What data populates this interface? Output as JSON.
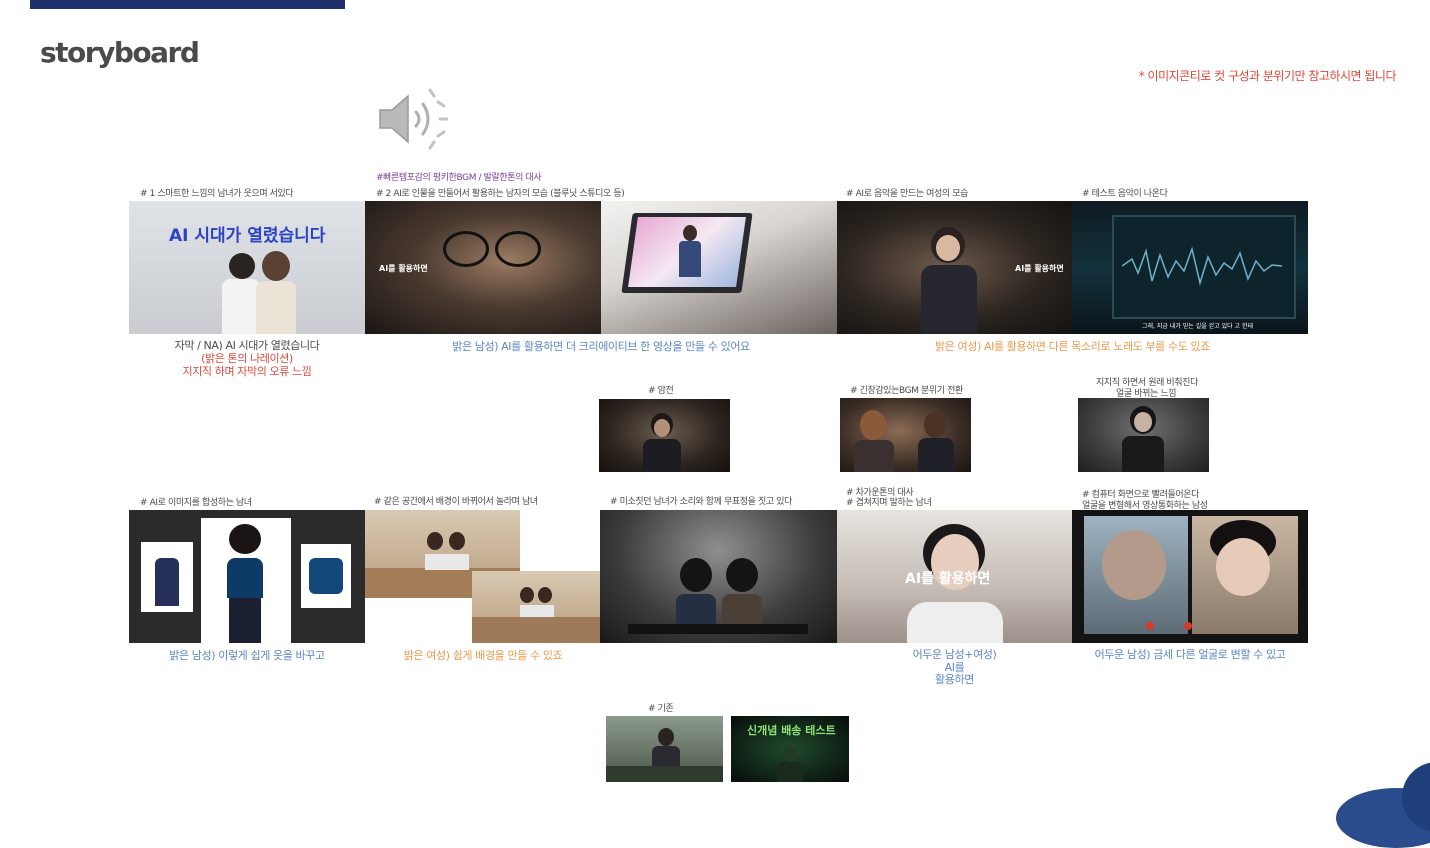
{
  "header": {
    "title": "storyboard",
    "note": "* 이미지콘티로 컷 구성과 분위기만 참고하시면 됩니다",
    "speaker_icon": "speaker-icon"
  },
  "row1": {
    "cap1": "# 1 스마트한 느낌의 남녀가 웃으며 서있다",
    "cap2_bgm": "#빠른템포감의 펑키한BGM / 발랄한톤의 대사",
    "cap2": "# 2 AI로 인물을 만들어서 활용하는 남자의 모습 (블루닛 스튜디오 등)",
    "cap4": "# AI로 음악을 만드는 여성의 모습",
    "cap5": "# 테스트 음악이 나온다",
    "frame1_text": "AI 시대가 열렸습니다",
    "frame2_text": "AI를 활용하면",
    "frame4_text": "AI를 활용하면",
    "frame5_text": "그래, 지금 내가 믿는 길을 걷고 있다 고 한테",
    "sub1_line1": "자막 / NA) AI 시대가 열렸습니다",
    "sub1_line2": "(밝은 톤의 나레이션)",
    "sub1_line3": "지지직 하며 자막의 오류 느낌",
    "sub2": "밝은 남성) AI를 활용하면 더 크리에이티브 한 영상을 만들 수 있어요",
    "sub3": "밝은 여성) AI를 활용하면 다른 목소리로 노래도 부를 수도 있죠"
  },
  "row2": {
    "cap_a": "# 암전",
    "cap_b": "# 긴장감있는BGM 분위기 전환",
    "cap_c_line1": "지지직 하면서 원래 비춰진다",
    "cap_c_line2": "얼굴 바뀌는 느낌"
  },
  "row3": {
    "cap1": "# AI로 이미지를 합성하는 남녀",
    "cap2": "# 같은 공간에서 배경이 바뀌어서 놀라며 남녀",
    "cap3": "# 미소짓던 남녀가 소리와 함께 무표정을 짓고 있다",
    "cap4_line1": "# 차가운톤의 대사",
    "cap4_line2": "# 겹쳐지며 말하는 남녀",
    "cap5_line1": "# 컴퓨터 화면으로 빨려들어온다",
    "cap5_line2": "얼굴을 변형해서 영상통화하는 남성",
    "frame4_text": "AI를 활용하면",
    "sub1": "밝은 남성) 이렇게 쉽게 옷을 바꾸고",
    "sub2": "밝은 여성) 쉽게 배경을 만들 수 있죠",
    "sub4_line1": "어두운 남성+여성)",
    "sub4_line2": "AI를",
    "sub4_line3": "활용하면",
    "sub5": "어두운 남성) 금세 다른 얼굴로 변할 수 있고"
  },
  "row4": {
    "cap": "# 기존",
    "frame2_text": "신개념 배송 테스트"
  },
  "colors": {
    "accent_navy": "#1f2f6b",
    "note_red": "#e2473a",
    "subtitle_blue": "#5b86c6",
    "subtitle_orange": "#ee9a4d",
    "subtitle_red": "#d94a3c",
    "bgm_purple": "#7a3f9b"
  }
}
